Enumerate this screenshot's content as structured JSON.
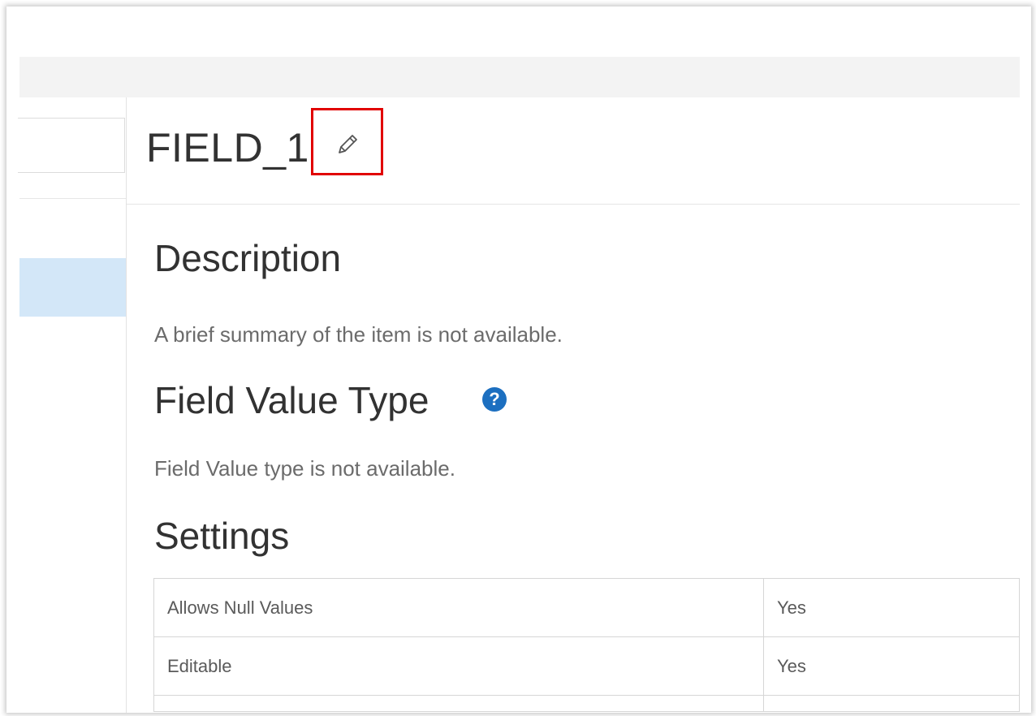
{
  "field": {
    "title": "FIELD_1",
    "edit_icon": "pencil-icon"
  },
  "description": {
    "heading": "Description",
    "text": "A brief summary of the item is not available."
  },
  "field_value_type": {
    "heading": "Field Value Type",
    "help_icon": "question-circle-icon",
    "help_glyph": "?",
    "text": "Field Value type is not available."
  },
  "settings": {
    "heading": "Settings",
    "rows": [
      {
        "label": "Allows Null Values",
        "value": "Yes"
      },
      {
        "label": "Editable",
        "value": "Yes"
      }
    ]
  },
  "colors": {
    "accent": "#1c6fc0",
    "highlight_box": "#e10000",
    "selected_row": "#d3e7f8"
  }
}
